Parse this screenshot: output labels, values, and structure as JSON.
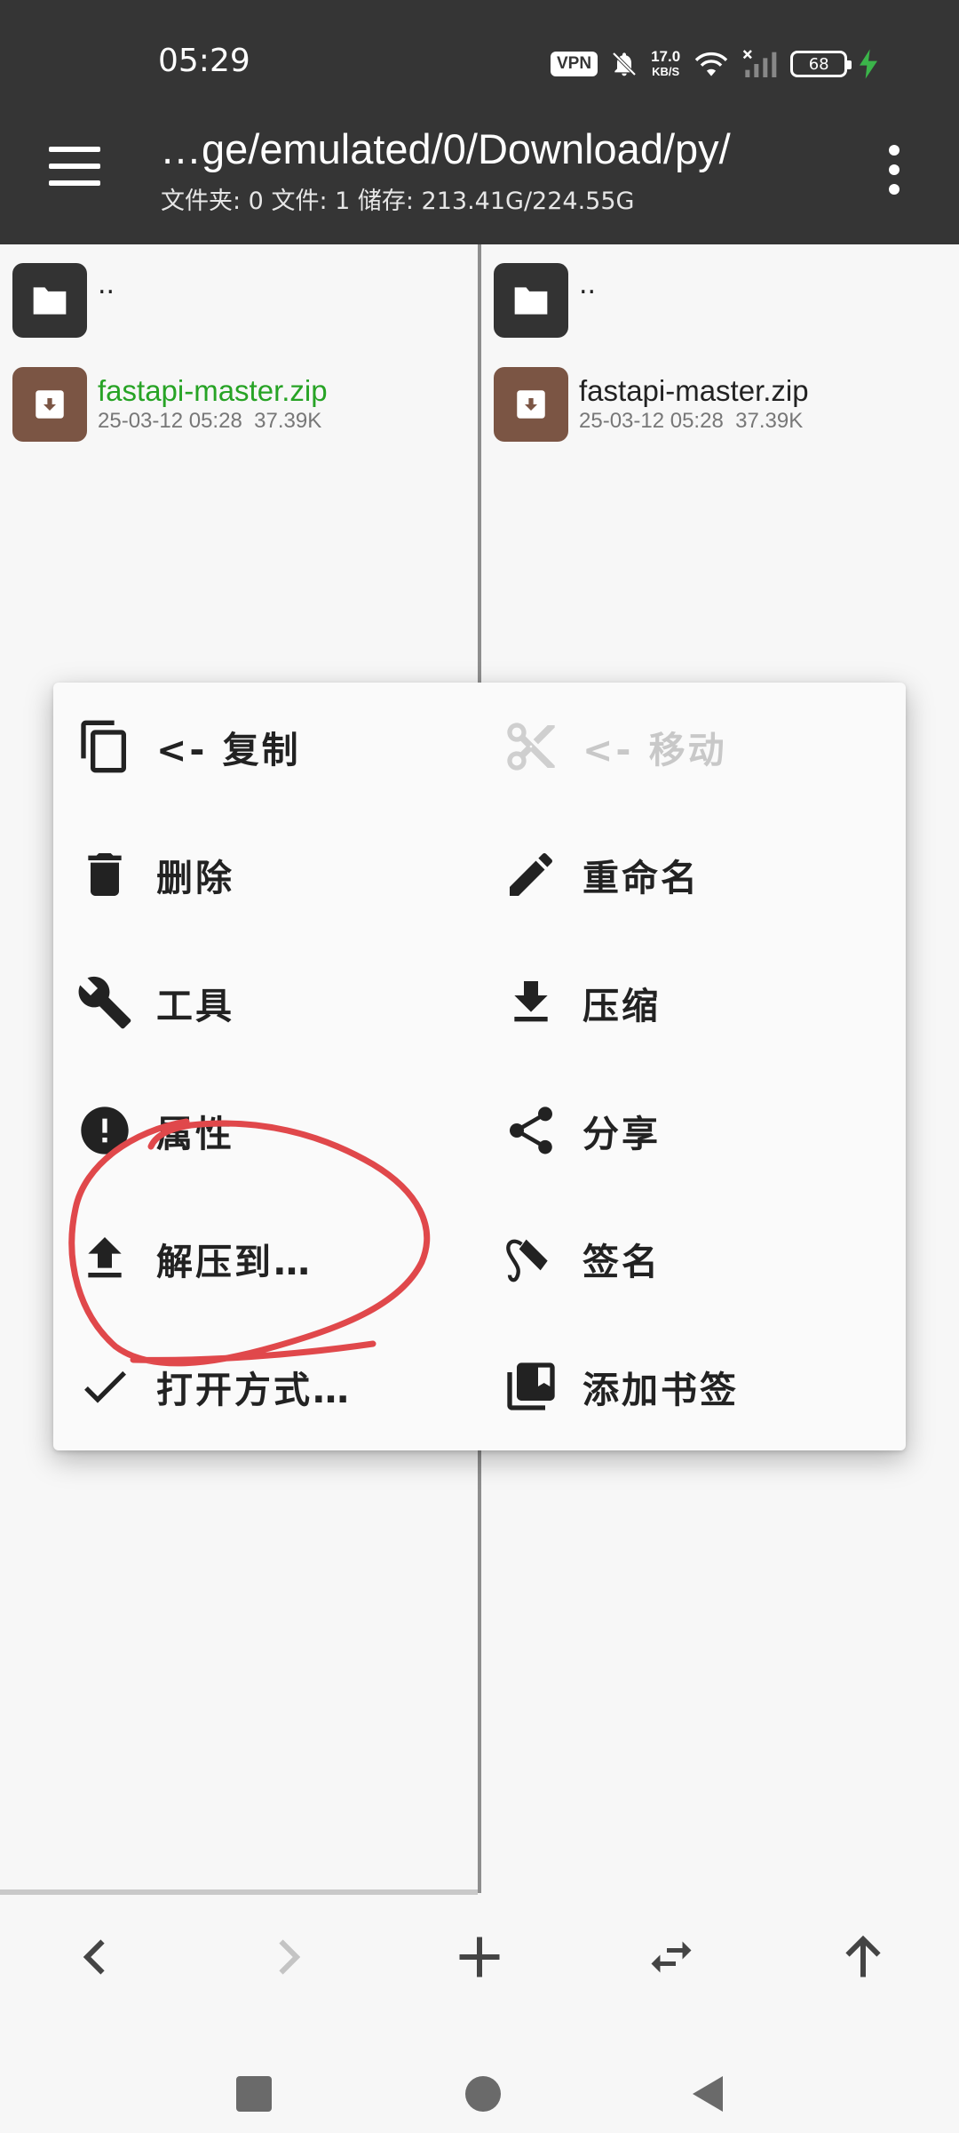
{
  "status_bar": {
    "time": "05:29",
    "vpn": "VPN",
    "speed_value": "17.0",
    "speed_unit": "KB/S",
    "battery": "68"
  },
  "header": {
    "path": "…ge/emulated/0/Download/py/",
    "stats": "文件夹: 0  文件: 1  储存: 213.41G/224.55G"
  },
  "left_pane": {
    "parent": "..",
    "file": {
      "name": "fastapi-master.zip",
      "date": "25-03-12 05:28",
      "size": "37.39K"
    }
  },
  "right_pane": {
    "parent": "..",
    "file": {
      "name": "fastapi-master.zip",
      "date": "25-03-12 05:28",
      "size": "37.39K"
    }
  },
  "context_menu": {
    "copy": "<- 复制",
    "move": "<- 移动",
    "delete": "删除",
    "rename": "重命名",
    "tools": "工具",
    "compress": "压缩",
    "properties": "属性",
    "share": "分享",
    "extract_to": "解压到…",
    "sign": "签名",
    "open_with": "打开方式…",
    "add_bookmark": "添加书签"
  },
  "colors": {
    "header_bg": "#353535",
    "accent_green": "#27a325",
    "annotation_red": "#e0484b",
    "zip_brown": "#7b5544"
  }
}
